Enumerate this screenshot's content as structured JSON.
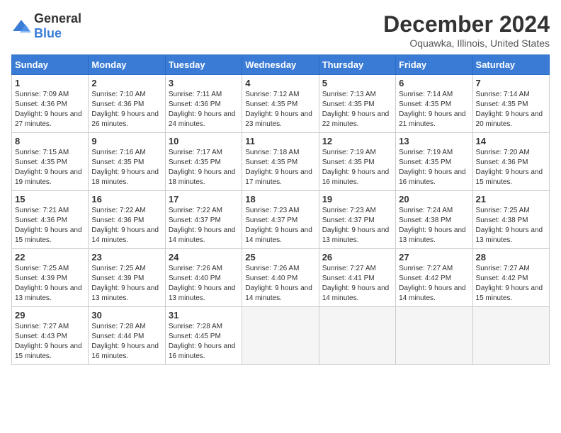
{
  "header": {
    "logo_general": "General",
    "logo_blue": "Blue",
    "month_title": "December 2024",
    "location": "Oquawka, Illinois, United States"
  },
  "days_of_week": [
    "Sunday",
    "Monday",
    "Tuesday",
    "Wednesday",
    "Thursday",
    "Friday",
    "Saturday"
  ],
  "weeks": [
    [
      {
        "day": "1",
        "sunrise": "7:09 AM",
        "sunset": "4:36 PM",
        "daylight": "9 hours and 27 minutes."
      },
      {
        "day": "2",
        "sunrise": "7:10 AM",
        "sunset": "4:36 PM",
        "daylight": "9 hours and 26 minutes."
      },
      {
        "day": "3",
        "sunrise": "7:11 AM",
        "sunset": "4:36 PM",
        "daylight": "9 hours and 24 minutes."
      },
      {
        "day": "4",
        "sunrise": "7:12 AM",
        "sunset": "4:35 PM",
        "daylight": "9 hours and 23 minutes."
      },
      {
        "day": "5",
        "sunrise": "7:13 AM",
        "sunset": "4:35 PM",
        "daylight": "9 hours and 22 minutes."
      },
      {
        "day": "6",
        "sunrise": "7:14 AM",
        "sunset": "4:35 PM",
        "daylight": "9 hours and 21 minutes."
      },
      {
        "day": "7",
        "sunrise": "7:14 AM",
        "sunset": "4:35 PM",
        "daylight": "9 hours and 20 minutes."
      }
    ],
    [
      {
        "day": "8",
        "sunrise": "7:15 AM",
        "sunset": "4:35 PM",
        "daylight": "9 hours and 19 minutes."
      },
      {
        "day": "9",
        "sunrise": "7:16 AM",
        "sunset": "4:35 PM",
        "daylight": "9 hours and 18 minutes."
      },
      {
        "day": "10",
        "sunrise": "7:17 AM",
        "sunset": "4:35 PM",
        "daylight": "9 hours and 18 minutes."
      },
      {
        "day": "11",
        "sunrise": "7:18 AM",
        "sunset": "4:35 PM",
        "daylight": "9 hours and 17 minutes."
      },
      {
        "day": "12",
        "sunrise": "7:19 AM",
        "sunset": "4:35 PM",
        "daylight": "9 hours and 16 minutes."
      },
      {
        "day": "13",
        "sunrise": "7:19 AM",
        "sunset": "4:35 PM",
        "daylight": "9 hours and 16 minutes."
      },
      {
        "day": "14",
        "sunrise": "7:20 AM",
        "sunset": "4:36 PM",
        "daylight": "9 hours and 15 minutes."
      }
    ],
    [
      {
        "day": "15",
        "sunrise": "7:21 AM",
        "sunset": "4:36 PM",
        "daylight": "9 hours and 15 minutes."
      },
      {
        "day": "16",
        "sunrise": "7:22 AM",
        "sunset": "4:36 PM",
        "daylight": "9 hours and 14 minutes."
      },
      {
        "day": "17",
        "sunrise": "7:22 AM",
        "sunset": "4:37 PM",
        "daylight": "9 hours and 14 minutes."
      },
      {
        "day": "18",
        "sunrise": "7:23 AM",
        "sunset": "4:37 PM",
        "daylight": "9 hours and 14 minutes."
      },
      {
        "day": "19",
        "sunrise": "7:23 AM",
        "sunset": "4:37 PM",
        "daylight": "9 hours and 13 minutes."
      },
      {
        "day": "20",
        "sunrise": "7:24 AM",
        "sunset": "4:38 PM",
        "daylight": "9 hours and 13 minutes."
      },
      {
        "day": "21",
        "sunrise": "7:25 AM",
        "sunset": "4:38 PM",
        "daylight": "9 hours and 13 minutes."
      }
    ],
    [
      {
        "day": "22",
        "sunrise": "7:25 AM",
        "sunset": "4:39 PM",
        "daylight": "9 hours and 13 minutes."
      },
      {
        "day": "23",
        "sunrise": "7:25 AM",
        "sunset": "4:39 PM",
        "daylight": "9 hours and 13 minutes."
      },
      {
        "day": "24",
        "sunrise": "7:26 AM",
        "sunset": "4:40 PM",
        "daylight": "9 hours and 13 minutes."
      },
      {
        "day": "25",
        "sunrise": "7:26 AM",
        "sunset": "4:40 PM",
        "daylight": "9 hours and 14 minutes."
      },
      {
        "day": "26",
        "sunrise": "7:27 AM",
        "sunset": "4:41 PM",
        "daylight": "9 hours and 14 minutes."
      },
      {
        "day": "27",
        "sunrise": "7:27 AM",
        "sunset": "4:42 PM",
        "daylight": "9 hours and 14 minutes."
      },
      {
        "day": "28",
        "sunrise": "7:27 AM",
        "sunset": "4:42 PM",
        "daylight": "9 hours and 15 minutes."
      }
    ],
    [
      {
        "day": "29",
        "sunrise": "7:27 AM",
        "sunset": "4:43 PM",
        "daylight": "9 hours and 15 minutes."
      },
      {
        "day": "30",
        "sunrise": "7:28 AM",
        "sunset": "4:44 PM",
        "daylight": "9 hours and 16 minutes."
      },
      {
        "day": "31",
        "sunrise": "7:28 AM",
        "sunset": "4:45 PM",
        "daylight": "9 hours and 16 minutes."
      },
      null,
      null,
      null,
      null
    ]
  ]
}
